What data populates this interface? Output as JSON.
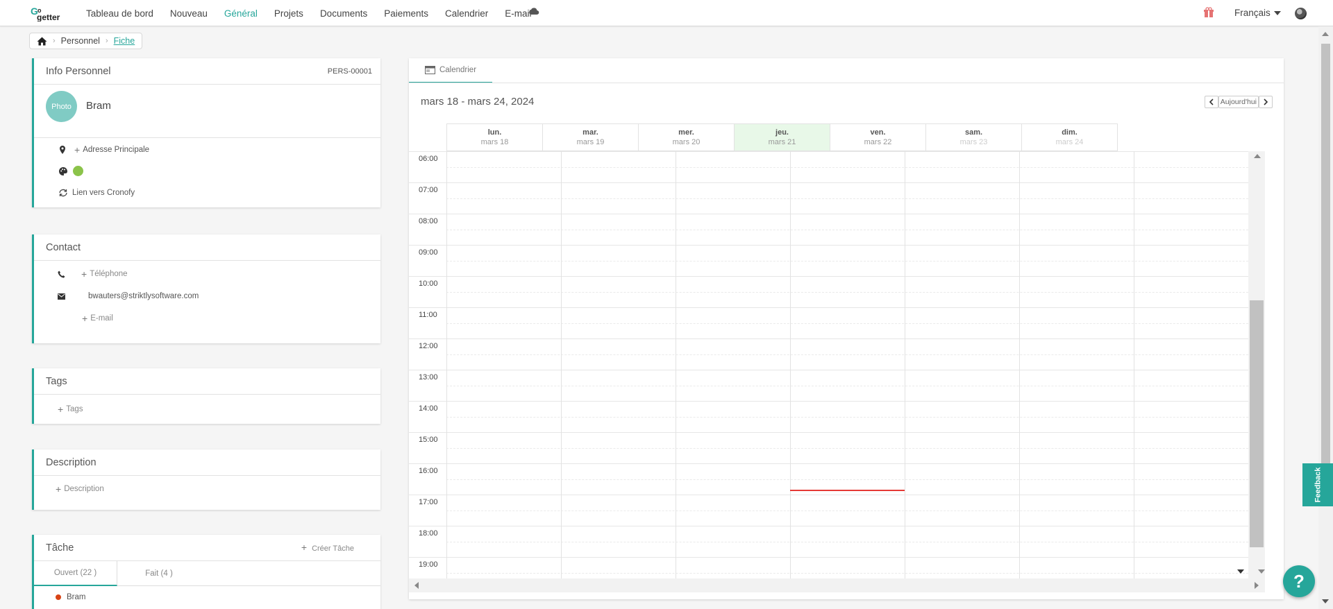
{
  "nav": {
    "logo_alt": "GoGetter",
    "items": [
      "Tableau de bord",
      "Nouveau",
      "Général",
      "Projets",
      "Documents",
      "Paiements",
      "Calendrier",
      "E-mail"
    ],
    "active": "Général",
    "language": "Français"
  },
  "breadcrumb": {
    "personnel": "Personnel",
    "fiche": "Fiche"
  },
  "info": {
    "title": "Info Personnel",
    "id": "PERS-00001",
    "photo_label": "Photo",
    "name": "Bram",
    "address": "Adresse Principale",
    "color": "#8bc34a",
    "cronofy": "Lien vers Cronofy"
  },
  "contact": {
    "title": "Contact",
    "phone_add": "Téléphone",
    "email": "bwauters@striktlysoftware.com",
    "email_add": "E-mail"
  },
  "tags": {
    "title": "Tags",
    "add": "Tags"
  },
  "description": {
    "title": "Description",
    "add": "Description"
  },
  "tasks": {
    "title": "Tâche",
    "create": "Créer Tâche",
    "tab_open": "Ouvert (22 )",
    "tab_done": "Fait (4 )",
    "first_item": "Bram"
  },
  "calendar": {
    "tab": "Calendrier",
    "range": "mars 18 - mars 24, 2024",
    "today_button": "Aujourd'hui",
    "days": [
      {
        "name": "lun.",
        "date": "mars 18"
      },
      {
        "name": "mar.",
        "date": "mars 19"
      },
      {
        "name": "mer.",
        "date": "mars 20"
      },
      {
        "name": "jeu.",
        "date": "mars 21",
        "today": true
      },
      {
        "name": "ven.",
        "date": "mars 22"
      },
      {
        "name": "sam.",
        "date": "mars 23"
      },
      {
        "name": "dim.",
        "date": "mars 24"
      }
    ],
    "hours": [
      "06:00",
      "07:00",
      "08:00",
      "09:00",
      "10:00",
      "11:00",
      "12:00",
      "13:00",
      "14:00",
      "15:00",
      "16:00",
      "17:00",
      "18:00",
      "19:00"
    ],
    "current_time_day": "jeu."
  },
  "widgets": {
    "feedback": "Feedback",
    "help": "?"
  },
  "colors": {
    "accent": "#26a69a",
    "today_bg": "#e8f8e8",
    "now_line": "#e53935",
    "gift": "#e57373"
  }
}
